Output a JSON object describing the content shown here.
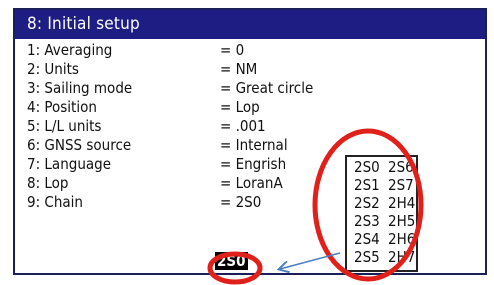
{
  "title": "8: Initial setup",
  "settings": [
    {
      "label": "1: Averaging",
      "value": "= 0"
    },
    {
      "label": "2: Units",
      "value": "= NM"
    },
    {
      "label": "3: Sailing mode",
      "value": "= Great circle"
    },
    {
      "label": "4: Position",
      "value": "= Lop"
    },
    {
      "label": "5: L/L units",
      "value": "= .001"
    },
    {
      "label": "6: GNSS source",
      "value": "= Internal"
    },
    {
      "label": "7: Language",
      "value": "= Engrish"
    },
    {
      "label": "8: Lop",
      "value": "= LoranA"
    },
    {
      "label": "9: Chain",
      "value": "= 2S0"
    }
  ],
  "chain_options": [
    [
      "2S0",
      "2S6"
    ],
    [
      "2S1",
      "2S7"
    ],
    [
      "2S2",
      "2H4"
    ],
    [
      "2S3",
      "2H5"
    ],
    [
      "2S4",
      "2H6"
    ],
    [
      "2S5",
      "2H7"
    ]
  ],
  "selected_chain": "2S0",
  "colors": {
    "titlebar": "#1e1d83",
    "highlight_circle": "#e0201a",
    "arrow": "#4a7fc1"
  }
}
